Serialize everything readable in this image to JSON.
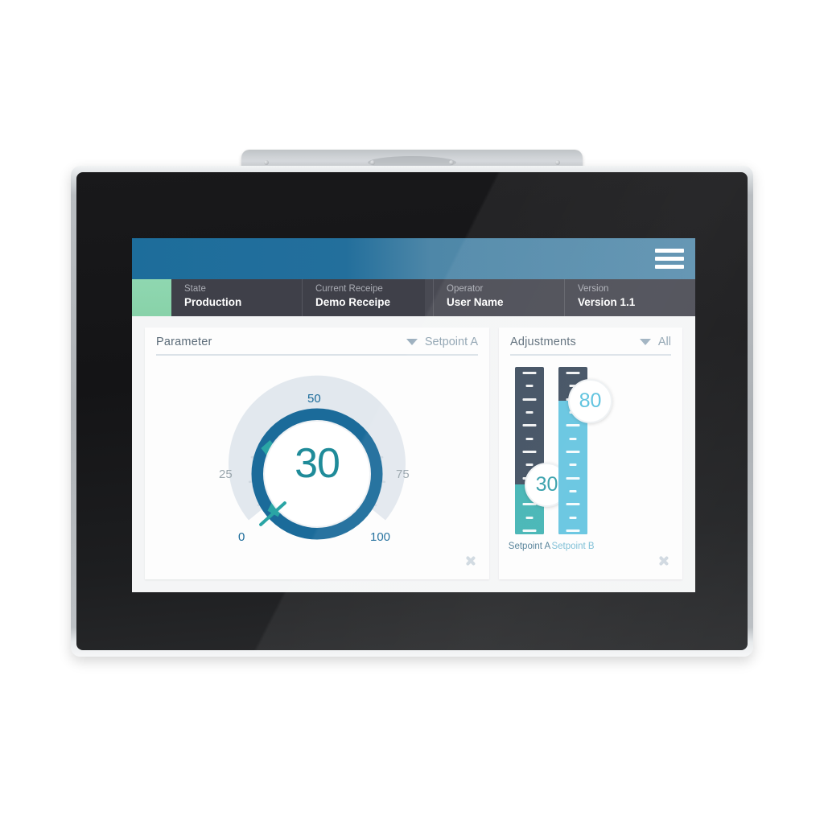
{
  "device": {
    "type": "industrial-hmi-touch-panel",
    "bezel_color": "#aeb2b6",
    "glass_color": "#18191b"
  },
  "header": {
    "gradient_from": "#1d6d9b",
    "gradient_to": "#5a8fae",
    "menu_icon": "hamburger-menu-icon"
  },
  "status_bar": {
    "background": "#3f4049",
    "indicator_color": "#8fd7b0",
    "cells": [
      {
        "label": "State",
        "value": "Production"
      },
      {
        "label": "Current Receipe",
        "value": "Demo Receipe"
      },
      {
        "label": "Operator",
        "value": "User Name"
      },
      {
        "label": "Version",
        "value": "Version 1.1"
      }
    ]
  },
  "parameter_card": {
    "title": "Parameter",
    "dropdown_icon": "chevron-down-icon",
    "dropdown_value": "Setpoint A",
    "next_icon": "chevron-right-icon",
    "gauge": {
      "value": "30",
      "value_color": "#1f8b99",
      "min": 0,
      "max": 100,
      "progress_color": "#2aa5a5",
      "ring_color": "#1b6b9a",
      "band_color": "#e2e8ee",
      "needle_color": "#2aa5a5",
      "tick_labels": [
        {
          "text": "0",
          "style": "major"
        },
        {
          "text": "25",
          "style": "minor"
        },
        {
          "text": "50",
          "style": "major"
        },
        {
          "text": "75",
          "style": "minor"
        },
        {
          "text": "100",
          "style": "major"
        }
      ]
    }
  },
  "adjustments_card": {
    "title": "Adjustments",
    "dropdown_icon": "chevron-down-icon",
    "dropdown_value": "All",
    "next_icon": "chevron-right-icon",
    "sliders": [
      {
        "label": "Setpoint A",
        "value": "30",
        "percent": 30,
        "fill_color": "#3fb3b3",
        "track_color": "#3d4c5e",
        "value_color": "#2e9ca8",
        "label_color": "#4c7b93"
      },
      {
        "label": "Setpoint B",
        "value": "80",
        "percent": 80,
        "fill_color": "#62c4e0",
        "track_color": "#3d4c5e",
        "value_color": "#55bfdd",
        "label_color": "#77bcd4"
      }
    ]
  },
  "chart_data": {
    "type": "gauge",
    "title": "Parameter - Setpoint A",
    "value": 30,
    "min": 0,
    "max": 100,
    "tick_values": [
      0,
      25,
      50,
      75,
      100
    ],
    "minor_ticks": 12,
    "series": [
      {
        "name": "Setpoint A",
        "value": 30,
        "unit": "%"
      },
      {
        "name": "Setpoint B",
        "value": 80,
        "unit": "%"
      }
    ]
  }
}
